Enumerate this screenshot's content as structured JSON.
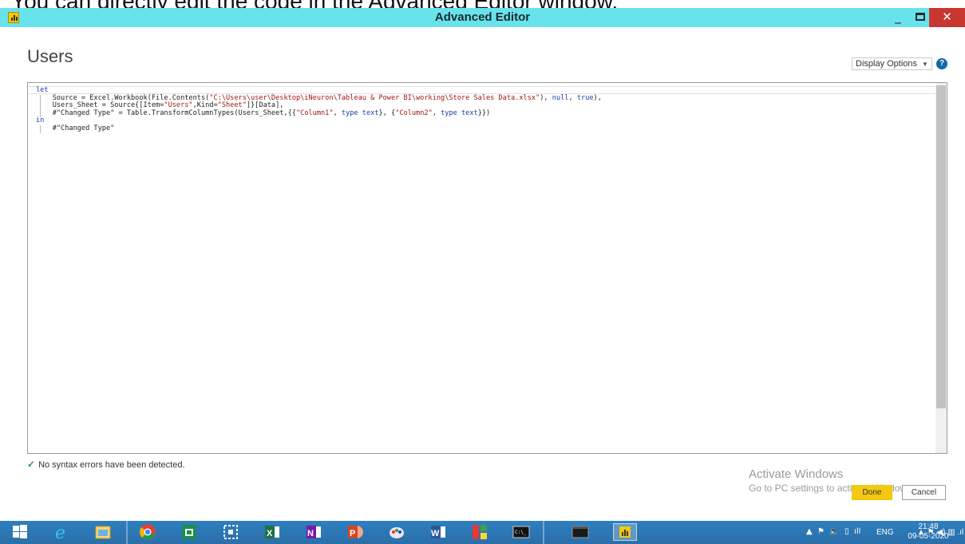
{
  "caption": "You can directly edit the code in the Advanced Editor window.",
  "window": {
    "title": "Advanced Editor",
    "controls": {
      "minimize": "_",
      "close": "✕"
    }
  },
  "header": {
    "title": "Users",
    "display_options_label": "Display Options",
    "help_symbol": "?"
  },
  "editor": {
    "lines": [
      [
        {
          "t": "let",
          "c": "kw"
        }
      ],
      [
        {
          "t": "    Source = Excel.Workbook(File.Contents(",
          "c": ""
        },
        {
          "t": "\"C:\\Users\\user\\Desktop\\iNeuron\\Tableau & Power BI\\working\\Store Sales Data.xlsx\"",
          "c": "str"
        },
        {
          "t": "), ",
          "c": ""
        },
        {
          "t": "null",
          "c": "kw"
        },
        {
          "t": ", ",
          "c": ""
        },
        {
          "t": "true",
          "c": "kw"
        },
        {
          "t": "),",
          "c": ""
        }
      ],
      [
        {
          "t": "    Users_Sheet = Source{[Item=",
          "c": ""
        },
        {
          "t": "\"Users\"",
          "c": "str"
        },
        {
          "t": ",Kind=",
          "c": ""
        },
        {
          "t": "\"Sheet\"",
          "c": "str"
        },
        {
          "t": "]}[Data],",
          "c": ""
        }
      ],
      [
        {
          "t": "    #\"Changed Type\" = Table.TransformColumnTypes(Users_Sheet,{{",
          "c": ""
        },
        {
          "t": "\"Column1\"",
          "c": "str"
        },
        {
          "t": ", ",
          "c": ""
        },
        {
          "t": "type text",
          "c": "kw"
        },
        {
          "t": "}, {",
          "c": ""
        },
        {
          "t": "\"Column2\"",
          "c": "str"
        },
        {
          "t": ", ",
          "c": ""
        },
        {
          "t": "type text",
          "c": "kw"
        },
        {
          "t": "}})",
          "c": ""
        }
      ],
      [
        {
          "t": "in",
          "c": "kw"
        }
      ],
      [
        {
          "t": "    #\"Changed Type\"",
          "c": ""
        }
      ]
    ]
  },
  "status": {
    "message": "No syntax errors have been detected."
  },
  "watermark": {
    "line1": "Activate Windows",
    "line2": "Go to PC settings to activate Windows."
  },
  "buttons": {
    "done": "Done",
    "cancel": "Cancel"
  },
  "taskbar": {
    "tray_language": "ENG",
    "clock_time": "21:48",
    "clock_date": "09-05-2020"
  },
  "colors": {
    "titlebar": "#68e3ec",
    "accent_button": "#f2c811",
    "close_button": "#c7372f",
    "taskbar": "#2e7fbf"
  }
}
